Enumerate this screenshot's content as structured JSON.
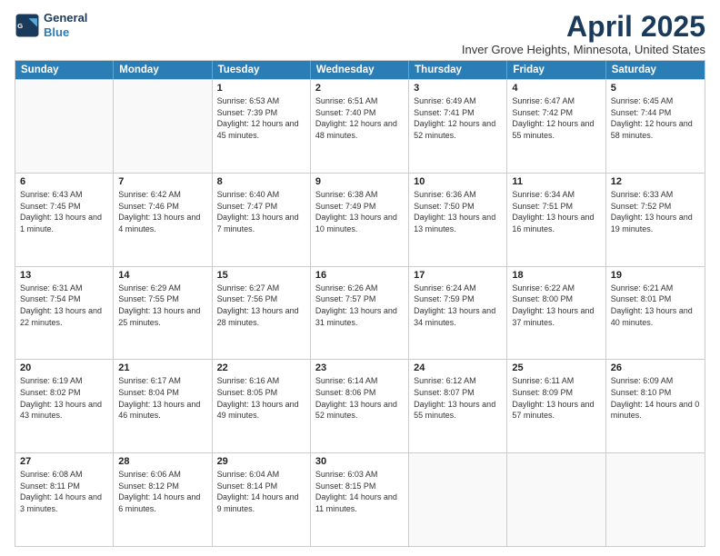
{
  "logo": {
    "line1": "General",
    "line2": "Blue"
  },
  "title": "April 2025",
  "location": "Inver Grove Heights, Minnesota, United States",
  "days_of_week": [
    "Sunday",
    "Monday",
    "Tuesday",
    "Wednesday",
    "Thursday",
    "Friday",
    "Saturday"
  ],
  "weeks": [
    [
      {
        "day": "",
        "text": ""
      },
      {
        "day": "",
        "text": ""
      },
      {
        "day": "1",
        "text": "Sunrise: 6:53 AM\nSunset: 7:39 PM\nDaylight: 12 hours and 45 minutes."
      },
      {
        "day": "2",
        "text": "Sunrise: 6:51 AM\nSunset: 7:40 PM\nDaylight: 12 hours and 48 minutes."
      },
      {
        "day": "3",
        "text": "Sunrise: 6:49 AM\nSunset: 7:41 PM\nDaylight: 12 hours and 52 minutes."
      },
      {
        "day": "4",
        "text": "Sunrise: 6:47 AM\nSunset: 7:42 PM\nDaylight: 12 hours and 55 minutes."
      },
      {
        "day": "5",
        "text": "Sunrise: 6:45 AM\nSunset: 7:44 PM\nDaylight: 12 hours and 58 minutes."
      }
    ],
    [
      {
        "day": "6",
        "text": "Sunrise: 6:43 AM\nSunset: 7:45 PM\nDaylight: 13 hours and 1 minute."
      },
      {
        "day": "7",
        "text": "Sunrise: 6:42 AM\nSunset: 7:46 PM\nDaylight: 13 hours and 4 minutes."
      },
      {
        "day": "8",
        "text": "Sunrise: 6:40 AM\nSunset: 7:47 PM\nDaylight: 13 hours and 7 minutes."
      },
      {
        "day": "9",
        "text": "Sunrise: 6:38 AM\nSunset: 7:49 PM\nDaylight: 13 hours and 10 minutes."
      },
      {
        "day": "10",
        "text": "Sunrise: 6:36 AM\nSunset: 7:50 PM\nDaylight: 13 hours and 13 minutes."
      },
      {
        "day": "11",
        "text": "Sunrise: 6:34 AM\nSunset: 7:51 PM\nDaylight: 13 hours and 16 minutes."
      },
      {
        "day": "12",
        "text": "Sunrise: 6:33 AM\nSunset: 7:52 PM\nDaylight: 13 hours and 19 minutes."
      }
    ],
    [
      {
        "day": "13",
        "text": "Sunrise: 6:31 AM\nSunset: 7:54 PM\nDaylight: 13 hours and 22 minutes."
      },
      {
        "day": "14",
        "text": "Sunrise: 6:29 AM\nSunset: 7:55 PM\nDaylight: 13 hours and 25 minutes."
      },
      {
        "day": "15",
        "text": "Sunrise: 6:27 AM\nSunset: 7:56 PM\nDaylight: 13 hours and 28 minutes."
      },
      {
        "day": "16",
        "text": "Sunrise: 6:26 AM\nSunset: 7:57 PM\nDaylight: 13 hours and 31 minutes."
      },
      {
        "day": "17",
        "text": "Sunrise: 6:24 AM\nSunset: 7:59 PM\nDaylight: 13 hours and 34 minutes."
      },
      {
        "day": "18",
        "text": "Sunrise: 6:22 AM\nSunset: 8:00 PM\nDaylight: 13 hours and 37 minutes."
      },
      {
        "day": "19",
        "text": "Sunrise: 6:21 AM\nSunset: 8:01 PM\nDaylight: 13 hours and 40 minutes."
      }
    ],
    [
      {
        "day": "20",
        "text": "Sunrise: 6:19 AM\nSunset: 8:02 PM\nDaylight: 13 hours and 43 minutes."
      },
      {
        "day": "21",
        "text": "Sunrise: 6:17 AM\nSunset: 8:04 PM\nDaylight: 13 hours and 46 minutes."
      },
      {
        "day": "22",
        "text": "Sunrise: 6:16 AM\nSunset: 8:05 PM\nDaylight: 13 hours and 49 minutes."
      },
      {
        "day": "23",
        "text": "Sunrise: 6:14 AM\nSunset: 8:06 PM\nDaylight: 13 hours and 52 minutes."
      },
      {
        "day": "24",
        "text": "Sunrise: 6:12 AM\nSunset: 8:07 PM\nDaylight: 13 hours and 55 minutes."
      },
      {
        "day": "25",
        "text": "Sunrise: 6:11 AM\nSunset: 8:09 PM\nDaylight: 13 hours and 57 minutes."
      },
      {
        "day": "26",
        "text": "Sunrise: 6:09 AM\nSunset: 8:10 PM\nDaylight: 14 hours and 0 minutes."
      }
    ],
    [
      {
        "day": "27",
        "text": "Sunrise: 6:08 AM\nSunset: 8:11 PM\nDaylight: 14 hours and 3 minutes."
      },
      {
        "day": "28",
        "text": "Sunrise: 6:06 AM\nSunset: 8:12 PM\nDaylight: 14 hours and 6 minutes."
      },
      {
        "day": "29",
        "text": "Sunrise: 6:04 AM\nSunset: 8:14 PM\nDaylight: 14 hours and 9 minutes."
      },
      {
        "day": "30",
        "text": "Sunrise: 6:03 AM\nSunset: 8:15 PM\nDaylight: 14 hours and 11 minutes."
      },
      {
        "day": "",
        "text": ""
      },
      {
        "day": "",
        "text": ""
      },
      {
        "day": "",
        "text": ""
      }
    ]
  ]
}
